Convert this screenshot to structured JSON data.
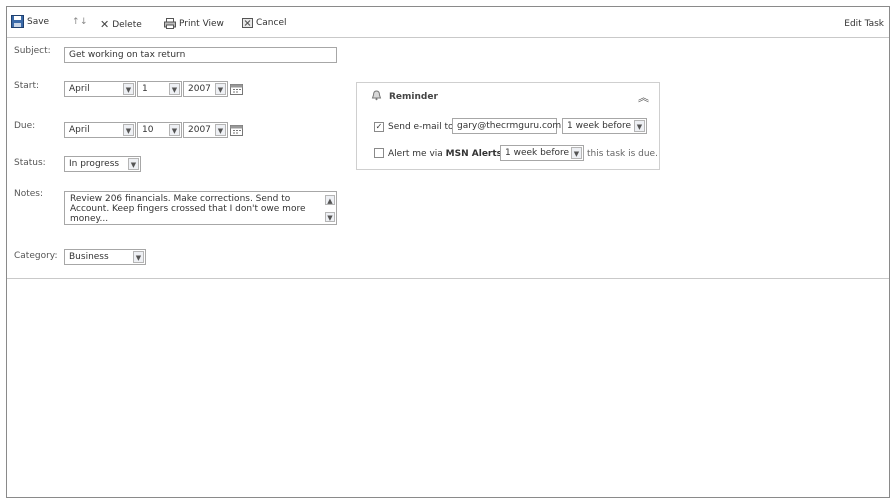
{
  "toolbar": {
    "save_label": "Save",
    "delete_label": "Delete",
    "print_label": "Print View",
    "cancel_label": "Cancel",
    "title": "Edit Task"
  },
  "form": {
    "subject_label": "Subject:",
    "subject_value": "Get working on tax return",
    "start_label": "Start:",
    "start": {
      "month": "April",
      "day": "1",
      "year": "2007"
    },
    "due_label": "Due:",
    "due": {
      "month": "April",
      "day": "10",
      "year": "2007"
    },
    "status_label": "Status:",
    "status_value": "In progress",
    "notes_label": "Notes:",
    "notes_value": "Review 206 financials.  Make corrections.  Send to Account.  Keep fingers crossed that I don't owe more money...",
    "category_label": "Category:",
    "category_value": "Business"
  },
  "reminder": {
    "title": "Reminder",
    "email": {
      "checked": true,
      "label": "Send e-mail to",
      "address": "gary@thecrmguru.com",
      "when": "1 week before"
    },
    "alert": {
      "checked": false,
      "label_prefix": "Alert me via",
      "service": "MSN Alerts",
      "when": "1 week before",
      "suffix": "this task is due."
    }
  },
  "icons": [
    "save-icon",
    "up-arrow-icon",
    "down-arrow-icon",
    "delete-icon",
    "print-icon",
    "cancel-icon",
    "calendar-icon",
    "bell-icon",
    "collapse-icon"
  ]
}
